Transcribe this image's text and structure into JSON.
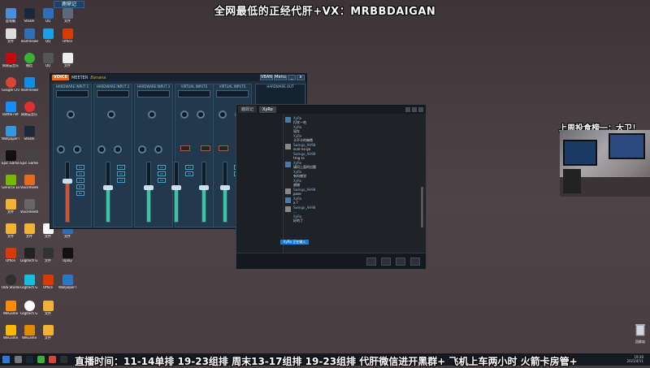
{
  "overlay": {
    "top_text": "全网最低的正经代肝+VX：MRBBDAIGAN",
    "right_title": "上周投食榜一：大卫！",
    "scrolling_text": "直播时间：11-14单排 19-23组排 周末13-17组排 19-23组排 代肝微信进开黑群+ 飞机上车两小时 火箭卡房管+"
  },
  "desktop_icons": [
    {
      "label": "此电脑",
      "color": "#4a8fd8"
    },
    {
      "label": "Steam",
      "color": "#1b2838"
    },
    {
      "label": "微信",
      "color": "#3cb034"
    },
    {
      "label": "QQ",
      "color": "#1aa0e8"
    },
    {
      "label": "Office",
      "color": "#d83b01"
    },
    {
      "label": "文件",
      "color": "#f2b233"
    },
    {
      "label": "Google Chrome",
      "color": "#db4437"
    },
    {
      "label": "TeamViewer",
      "color": "#0e8ee9"
    },
    {
      "label": "WeGame",
      "color": "#ff8a00"
    },
    {
      "label": "Discord",
      "color": "#7289da"
    },
    {
      "label": "网易云音乐",
      "color": "#c20c0c"
    },
    {
      "label": "Battle.net",
      "color": "#148eff"
    },
    {
      "label": "Epic Games",
      "color": "#333"
    },
    {
      "label": "GeForce Experience",
      "color": "#76b900"
    },
    {
      "label": "Voicemeeter",
      "color": "#e66a1e"
    },
    {
      "label": "OBS Studio",
      "color": "#302e31"
    },
    {
      "label": "Logitech G HUB",
      "color": "#0fc0e0"
    },
    {
      "label": "Wallpaper Engine",
      "color": "#2c76c8"
    },
    {
      "label": "Uplay",
      "color": "#1a5bc8"
    },
    {
      "label": "回收站",
      "color": "#888"
    }
  ],
  "voicemeeter": {
    "logo": "VOICE",
    "title": "MEETER",
    "brand": "Banana",
    "strips": [
      {
        "label": "HARDWARE INPUT 1"
      },
      {
        "label": "HARDWARE INPUT 2"
      },
      {
        "label": "HARDWARE INPUT 3"
      },
      {
        "label": "VIRTUAL INPUTS"
      },
      {
        "label": "VIRTUAL INPUTS"
      }
    ],
    "hw_out_label": "HARDWARE OUT",
    "bus_labels": [
      "A1",
      "A2",
      "A3",
      "B1",
      "B2"
    ],
    "buttons": [
      "VBAN",
      "Menu"
    ]
  },
  "chat": {
    "tabs": [
      "鹿鼎记",
      "XyRo"
    ],
    "messages": [
      {
        "name": "XyRo",
        "text": "打扰一哈"
      },
      {
        "name": "XyRo",
        "text": "现在"
      },
      {
        "name": "XyRo",
        "text": "卡不卡的嘛哦"
      },
      {
        "name": "Swingo_AH98",
        "text": "sure no go"
      },
      {
        "name": "Swingo_AH98",
        "text": "trng ss"
      },
      {
        "name": "XyRo",
        "text": "请问上面的出题"
      },
      {
        "name": "XyRo",
        "text": "有吗感觉"
      },
      {
        "name": "XyRo",
        "text": "谢谢"
      },
      {
        "name": "Swingo_AH98",
        "text": "pase"
      },
      {
        "name": "XyRo",
        "text": "a ?"
      },
      {
        "name": "Swingo_AH98",
        "text": "..."
      },
      {
        "name": "XyRo",
        "text": "好的了"
      }
    ],
    "highlight": "XyRo 正在输入"
  },
  "clock": {
    "time": "19:30",
    "date": "2021/4/11"
  }
}
